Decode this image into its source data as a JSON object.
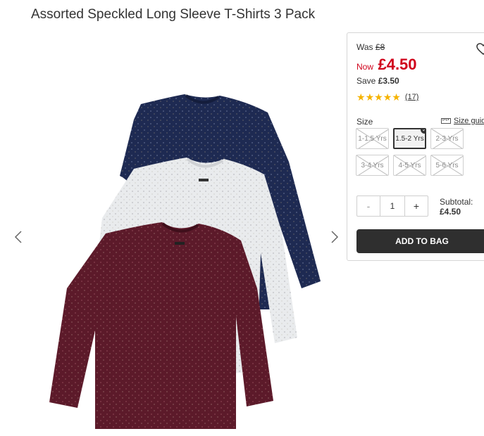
{
  "product": {
    "title": "Assorted Speckled Long Sleeve T-Shirts 3 Pack"
  },
  "gallery": {
    "image_alt": "Three speckled long sleeve t-shirts: navy, grey, burgundy",
    "shirt_colors": {
      "navy": "#1e2a52",
      "grey": "#e9ebed",
      "burgundy": "#5c1a2a"
    },
    "prev_icon": "chevron-left-icon",
    "next_icon": "chevron-right-icon"
  },
  "pricing": {
    "was_label": "Was",
    "was_price": "£8",
    "now_label": "Now",
    "now_price": "£4.50",
    "save_label": "Save",
    "save_amount": "£3.50",
    "accent_color": "#d0021b"
  },
  "rating": {
    "stars": 5,
    "review_count": "(17)",
    "star_color": "#f5b301"
  },
  "wishlist": {
    "icon": "heart-icon"
  },
  "size": {
    "label": "Size",
    "guide_label": "Size guide",
    "options": [
      {
        "label": "1-1.5 Yrs",
        "available": false,
        "selected": false
      },
      {
        "label": "1.5-2 Yrs",
        "available": true,
        "selected": true
      },
      {
        "label": "2-3 Yrs",
        "available": false,
        "selected": false
      },
      {
        "label": "3-4 Yrs",
        "available": false,
        "selected": false
      },
      {
        "label": "4-5 Yrs",
        "available": false,
        "selected": false
      },
      {
        "label": "5-6 Yrs",
        "available": false,
        "selected": false
      }
    ]
  },
  "quantity": {
    "minus": "-",
    "value": "1",
    "plus": "+"
  },
  "subtotal": {
    "label": "Subtotal:",
    "value": "£4.50"
  },
  "cart": {
    "add_label": "ADD TO BAG"
  }
}
